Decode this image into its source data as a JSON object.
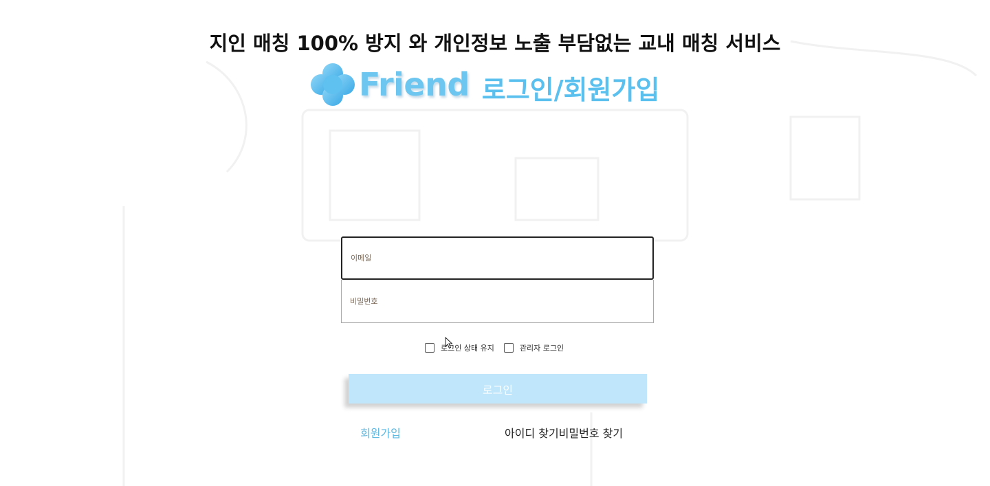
{
  "header": {
    "tagline": "지인 매칭 100% 방지 와 개인정보 노출 부담없는 교내 매칭 서비스",
    "brand_name": "Friend",
    "page_title": "로그인/회원가입",
    "logo_icon": "cloud-logo-icon"
  },
  "form": {
    "email_placeholder": "이메일",
    "password_placeholder": "비밀번호",
    "remember_label": "로그인 상태 유지",
    "admin_label": "관리자 로그인",
    "login_label": "로그인"
  },
  "links": {
    "signup_label": "회원가입",
    "find_id_label": "아이디 찾기",
    "find_password_label": "비밀번호 찾기"
  },
  "colors": {
    "brand": "#5cc0ef",
    "button": "#bfe6fa"
  }
}
